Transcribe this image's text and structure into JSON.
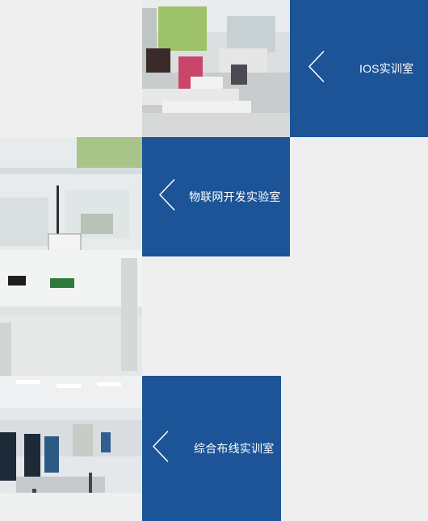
{
  "labs": [
    {
      "title": "IOS实训室",
      "photo": "ios-classroom-photo",
      "icon": "chevron-left-icon"
    },
    {
      "title": "物联网开发实验室",
      "photo": "iot-lab-photo",
      "icon": "chevron-left-icon"
    },
    {
      "title": "综合布线实训室",
      "photo": "wiring-lab-photo",
      "icon": "chevron-left-icon"
    }
  ],
  "colors": {
    "tile_background": "#1c5497",
    "page_background": "#efefef",
    "text": "#ffffff"
  }
}
